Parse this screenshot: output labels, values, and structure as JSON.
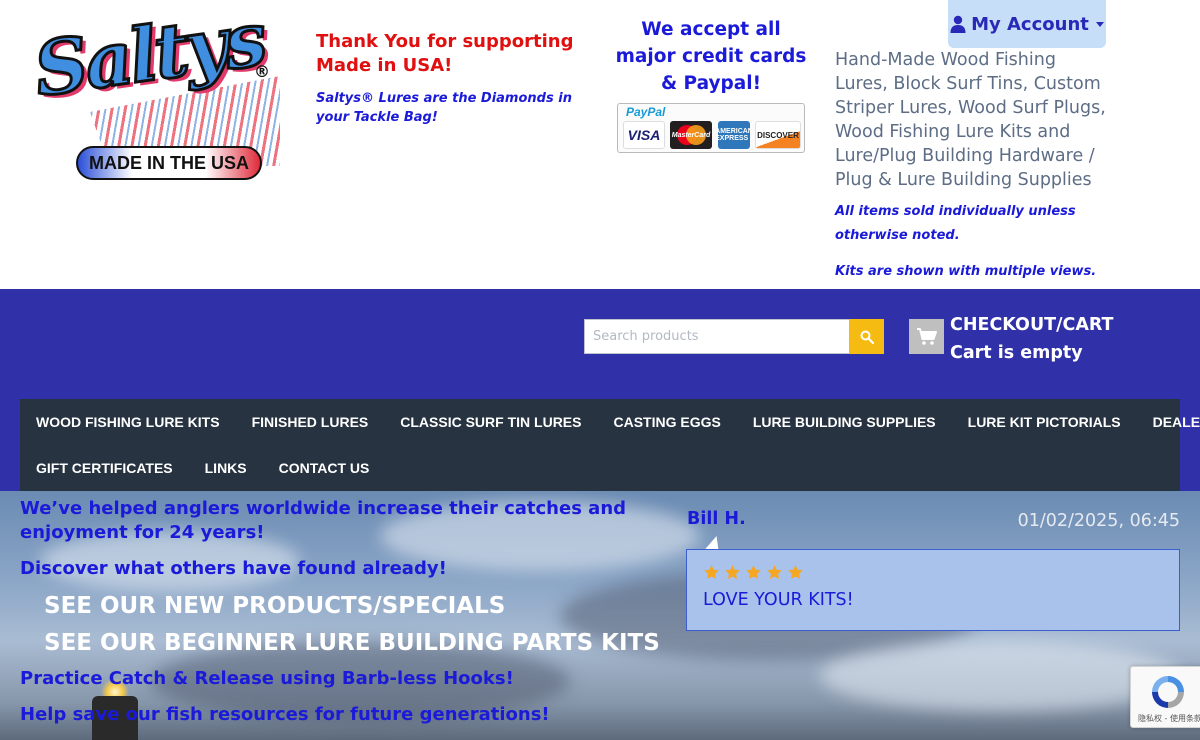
{
  "header": {
    "logo": {
      "wordmark": "Saltys",
      "registered": "®",
      "banner": "MADE IN THE USA"
    },
    "thanks": "Thank You for supporting Made in USA!",
    "tagline": "Saltys® Lures are the Diamonds in your Tackle Bag!",
    "cards_text": "We accept all major credit cards & Paypal!",
    "payment_logos": {
      "paypal": "PayPal",
      "cards": [
        "VISA",
        "MasterCard",
        "AMERICAN EXPRESS",
        "DISCOVER"
      ]
    },
    "account_label": "My Account",
    "description": "Hand-Made Wood Fishing Lures, Block Surf Tins, Custom Striper Lures, Wood Surf Plugs, Wood Fishing Lure Kits and Lure/Plug Building Hardware / Plug & Lure Building Supplies",
    "note_individual": "All items sold individually unless otherwise noted.",
    "note_kits": "Kits are shown with multiple views."
  },
  "search": {
    "placeholder": "Search products",
    "value": ""
  },
  "cart": {
    "checkout_label": "CHECKOUT/CART",
    "status": "Cart is empty"
  },
  "nav": {
    "row1": [
      "WOOD FISHING LURE KITS",
      "FINISHED LURES",
      "CLASSIC SURF TIN LURES",
      "CASTING EGGS",
      "LURE BUILDING SUPPLIES",
      "LURE KIT PICTORIALS",
      "DEALERS"
    ],
    "row2": [
      "GIFT CERTIFICATES",
      "LINKS",
      "CONTACT US"
    ]
  },
  "hero": {
    "line1": "We’ve helped anglers worldwide increase their catches and enjoyment for 24 years!",
    "line2": "Discover what others have found already!",
    "link_new": "SEE OUR NEW PRODUCTS/SPECIALS",
    "link_beginner": "SEE OUR BEGINNER LURE BUILDING PARTS KITS",
    "line_release": "Practice Catch & Release using Barb-less Hooks!",
    "line_save": "Help save our fish resources for future generations!"
  },
  "review": {
    "reviewer": "Bill H.",
    "date": "01/02/2025, 06:45",
    "rating": 5,
    "text": "LOVE YOUR KITS!"
  },
  "recaptcha": {
    "footer": "隐私权 - 使用条款"
  },
  "colors": {
    "brand_blue": "#3030a8",
    "nav_dark": "#273340",
    "link_blue": "#1a1ad8",
    "alert_red": "#e01010",
    "search_button": "#f5bb13",
    "star": "#f5a623"
  },
  "icons": [
    "user-icon",
    "search-icon",
    "cart-icon",
    "star-icon",
    "recaptcha-icon"
  ]
}
